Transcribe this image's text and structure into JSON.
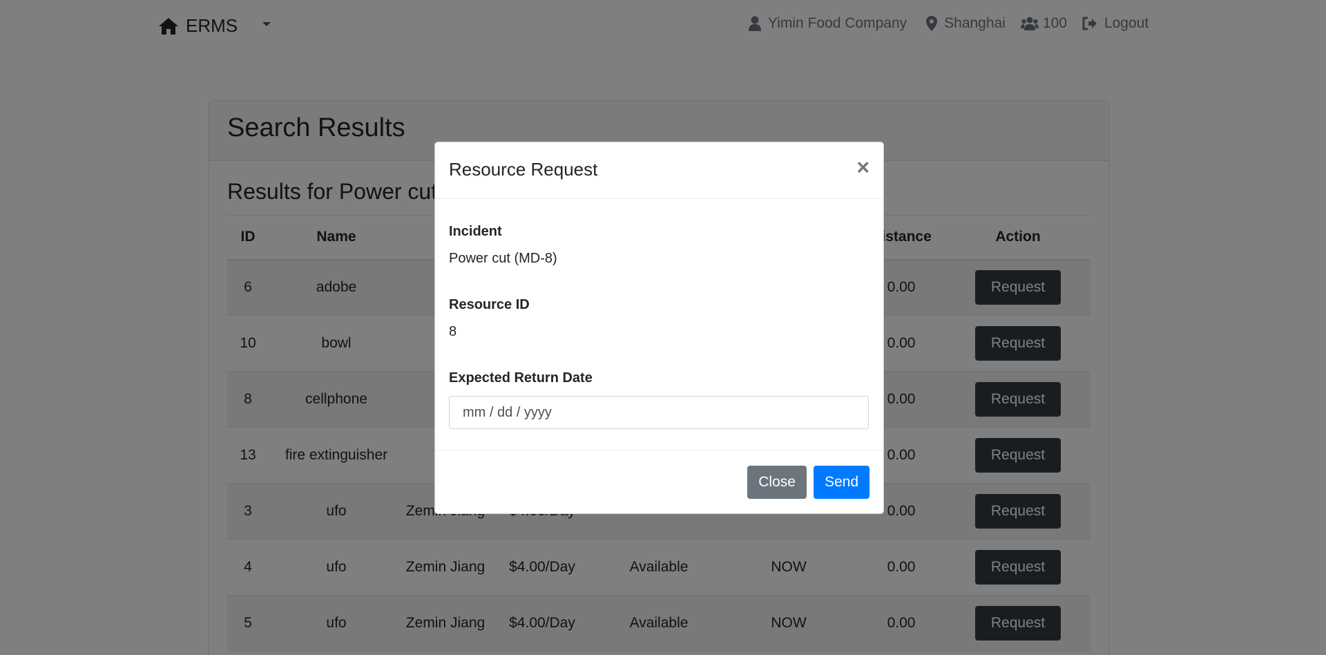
{
  "navbar": {
    "brand": "ERMS",
    "company": "Yimin Food Company",
    "location": "Shanghai",
    "users_count": "100",
    "logout": "Logout"
  },
  "page": {
    "title": "Search Results",
    "results_for": "Results for Power cut"
  },
  "table": {
    "headers": [
      "ID",
      "Name",
      "",
      "",
      "",
      "",
      "Distance",
      "Action"
    ],
    "rows": [
      {
        "id": "6",
        "name": "adobe",
        "owner": "Ze",
        "rate": "",
        "status": "",
        "avail": "",
        "distance": "0.00",
        "action": "Request"
      },
      {
        "id": "10",
        "name": "bowl",
        "owner": "Ze",
        "rate": "",
        "status": "",
        "avail": "",
        "distance": "0.00",
        "action": "Request"
      },
      {
        "id": "8",
        "name": "cellphone",
        "owner": "Ze",
        "rate": "",
        "status": "",
        "avail": "",
        "distance": "0.00",
        "action": "Request"
      },
      {
        "id": "13",
        "name": "fire extinguisher",
        "owner": "Ze",
        "rate": "",
        "status": "",
        "avail": "",
        "distance": "0.00",
        "action": "Request"
      },
      {
        "id": "3",
        "name": "ufo",
        "owner": "Zemin Jiang",
        "rate": "$4.00/Day",
        "status": "",
        "avail": "",
        "distance": "0.00",
        "action": "Request"
      },
      {
        "id": "4",
        "name": "ufo",
        "owner": "Zemin Jiang",
        "rate": "$4.00/Day",
        "status": "Available",
        "avail": "NOW",
        "distance": "0.00",
        "action": "Request"
      },
      {
        "id": "5",
        "name": "ufo",
        "owner": "Zemin Jiang",
        "rate": "$4.00/Day",
        "status": "Available",
        "avail": "NOW",
        "distance": "0.00",
        "action": "Request"
      }
    ]
  },
  "modal": {
    "title": "Resource Request",
    "close_symbol": "×",
    "incident_label": "Incident",
    "incident_value": "Power cut (MD-8)",
    "resource_id_label": "Resource ID",
    "resource_id_value": "8",
    "return_date_label": "Expected Return Date",
    "return_date_placeholder": "mm / dd / yyyy",
    "close_button": "Close",
    "send_button": "Send"
  }
}
